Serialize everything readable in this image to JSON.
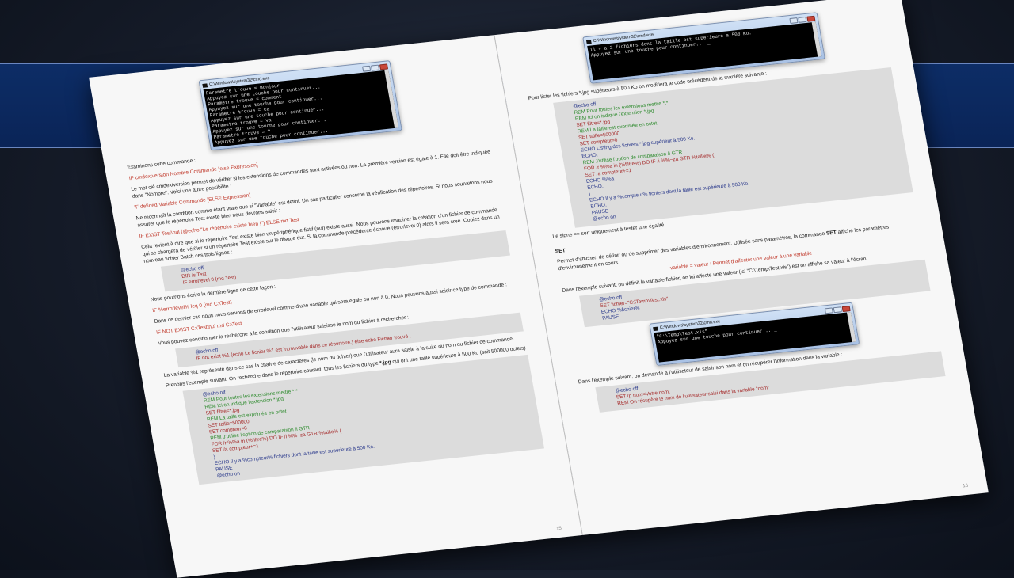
{
  "left": {
    "console1": {
      "title": "C:\\Windows\\system32\\cmd.exe",
      "lines": [
        "Parametre trouve = Bonjour",
        "Appuyez sur une touche pour continuer...",
        "Parametre trouve = comment",
        "Appuyez sur une touche pour continuer...",
        "Parametre trouve = ca",
        "Appuyez sur une touche pour continuer...",
        "Parametre trouve = va",
        "Appuyez sur une touche pour continuer...",
        "Parametre trouve = ?",
        "Appuyez sur une touche pour continuer..."
      ]
    },
    "p1": "Examinons cette commande :",
    "syn1": "IF cmdextversion Nombre Commande [else Expression]",
    "p2": "Le mot clé cmdextversion permet de vérifier si les extensions de commandes sont activées ou non. La première version est égale à 1. Elle doit être indiquée dans \"Nombre\". Voici une autre possibilité :",
    "syn2": "IF defined Variable Commande [ELSE Expression]",
    "p3": "Ne reconnaît la condition comme étant vraie que si \"Variable\" est défini. Un cas particulier concerne la vérification des répertoires. Si nous souhaitons nous assurer que le répertoire Test existe bien nous devrons saisir :",
    "syn3": "IF EXIST Test\\nul (@echo \"Le répertoire existe bien !\") ELSE md Test",
    "p4": "Cela revient à dire que si le répertoire Test existe bien un périphérique fictif (nul) existe aussi. Nous pouvons imaginer la création d'un fichier de commande qui se chargera de vérifier si un répertoire Test existe sur le disque dur. Si la commande précédente échoue (errorlevel 0) alors il sera créé. Copiez dans un nouveau fichier Batch ces trois lignes :",
    "code1": [
      "@echo off",
      "DIR /s Test",
      "IF errorlevel 0 (md Test)"
    ],
    "p5": "Nous pourrions écrire la dernière ligne de cette façon :",
    "syn4": "IF %errorlevel% leq 0 (md C:\\Test)",
    "p6": "Dans ce dernier cas nous nous servons de errorlevel comme d'une variable qui sera égale ou non à 0. Nous pouvons aussi saisir ce type de commande :",
    "syn5": "IF NOT EXIST C:\\Test\\nul md C:\\Test",
    "p7": "Vous pouvez conditionner la recherche à la condition que l'utilisateur saisisse le nom du fichier à rechercher :",
    "code2": [
      "@echo off",
      "IF not exist %1 (echo Le fichier %1 est introuvable dans ce répertoire.) else echo Fichier trouvé !"
    ],
    "p8": "La variable %1 représente dans ce cas la chaîne de caractères (le nom du fichier) que l'utilisateur aura saisie à la suite du nom du fichier de commande.",
    "p9a": "Prenons l'exemple suivant. On recherche dans le répertoire courant, tous les fichiers du type ",
    "p9b": "*.jpg",
    "p9c": " qui ont une taille supérieure à 500 Ko (soit 500000 octets)",
    "code3": [
      [
        "@echo off",
        "blue"
      ],
      [
        "REM Pour toutes les extensions mettre *.*",
        "green"
      ],
      [
        "REM Ici on indique l'extension *.jpg",
        "green"
      ],
      [
        "SET filtre=*.jpg",
        "red"
      ],
      [
        "REM La taille est exprimée en octet",
        "green"
      ],
      [
        "SET taille=500000",
        "red"
      ],
      [
        "SET compteur=0",
        "red"
      ],
      [
        "REM J'utilise l'option de comparaison /i GTR",
        "green"
      ],
      [
        "FOR /r %%a in (%filtre%) DO IF /i %%~za GTR %taille% (",
        "red"
      ],
      [
        "SET /a compteur+=1",
        "red"
      ],
      [
        ")",
        "blue"
      ],
      [
        "ECHO Il y a %compteur% fichiers dont la taille est supérieure à 500 Ko.",
        "blue"
      ],
      [
        "PAUSE",
        "blue"
      ],
      [
        "@echo on",
        "blue"
      ]
    ],
    "page_number": "15"
  },
  "right": {
    "console2": {
      "title": "C:\\Windows\\system32\\cmd.exe",
      "lines": [
        "Il y a 2 fichiers dont la taille est superieure a 500 Ko.",
        "Appuyez sur une touche pour continuer... _"
      ]
    },
    "p1": "Pour lister les fichiers *.jpg supérieurs à 500 Ko on modifiera le code précédent de la manière suivante :",
    "code1": [
      [
        "@echo off",
        "blue"
      ],
      [
        "REM Pour toutes les extensions mettre *.*",
        "green"
      ],
      [
        "REM Ici on indique l'extension *.jpg",
        "green"
      ],
      [
        "SET filtre=*.jpg",
        "red"
      ],
      [
        "REM La taille est exprimée en octet",
        "green"
      ],
      [
        "SET taille=500000",
        "red"
      ],
      [
        "SET compteur=0",
        "red"
      ],
      [
        "ECHO Listing des fichiers *.jpg supérieur à 500 Ko.",
        "blue"
      ],
      [
        "ECHO.",
        "blue"
      ],
      [
        "REM J'utilise l'option de comparaison /i GTR",
        "green"
      ],
      [
        "FOR /r %%a in (%filtre%) DO IF /i %%~za GTR %taille% (",
        "red"
      ],
      [
        "SET /a compteur+=1",
        "red"
      ],
      [
        "ECHO %%a",
        "blue"
      ],
      [
        "ECHO.",
        "blue"
      ],
      [
        ")",
        "blue"
      ],
      [
        "ECHO Il y a %compteur% fichiers dont la taille est supérieure à 500 Ko.",
        "blue"
      ],
      [
        "ECHO.",
        "blue"
      ],
      [
        "PAUSE",
        "blue"
      ],
      [
        "@echo on",
        "blue"
      ]
    ],
    "p2": "Le signe == sert uniquement à tester une égalité.",
    "h_set": "SET",
    "p3a": "Permet d'afficher, de définir ou de supprimer des variables d'environnement. Utilisée sans paramètres, la commande ",
    "p3b": "SET",
    "p3c": " affiche les paramètres d'environnement en cours.",
    "syn1": "variable = valeur : Permet d'affecter une valeur à une variable",
    "p4": "Dans l'exemple suivant, on définit la variable fichier, on lui affecte une valeur (ici \"C:\\Temp\\Test.xls\") est on affiche sa valeur à l'écran.",
    "code2": [
      [
        "@echo off",
        "blue"
      ],
      [
        "SET fichier=\"C:\\Temp\\Test.xls\"",
        "red"
      ],
      [
        "ECHO %fichier%",
        "blue"
      ],
      [
        "PAUSE",
        "blue"
      ]
    ],
    "console3": {
      "title": "C:\\Windows\\system32\\cmd.exe",
      "lines": [
        "\"C:\\Temp\\Test.xls\"",
        "Appuyez sur une touche pour continuer... _"
      ]
    },
    "p5": "Dans l'exemple suivant, on demande à l'utilisateur de saisir son nom et on récupérer l'information dans la variable :",
    "code3": [
      [
        "@echo off",
        "blue"
      ],
      [
        "SET /p nom=Votre nom:",
        "red"
      ],
      [
        "REM On récupère le nom de l'utilisateur saisi dans la variable \"nom\"",
        "red"
      ]
    ],
    "page_number": "16"
  }
}
